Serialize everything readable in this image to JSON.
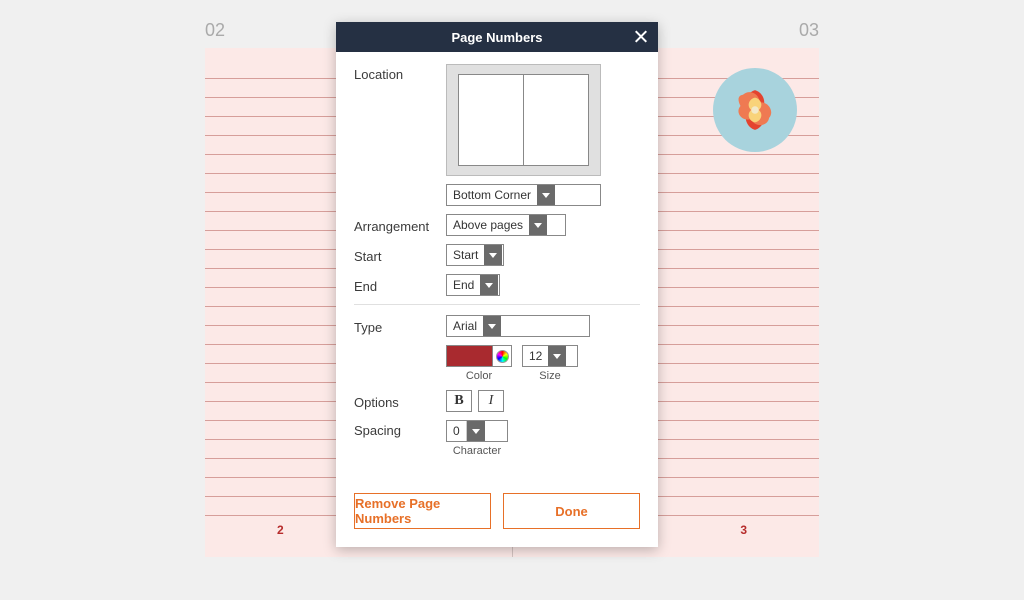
{
  "spread": {
    "left_header": "02",
    "right_header": "03",
    "left_bottom": "2",
    "right_bottom": "3"
  },
  "dialog": {
    "title": "Page Numbers",
    "labels": {
      "location": "Location",
      "arrangement": "Arrangement",
      "start": "Start",
      "end": "End",
      "type": "Type",
      "options": "Options",
      "spacing": "Spacing",
      "color": "Color",
      "size": "Size",
      "character": "Character"
    },
    "values": {
      "location": "Bottom Corner",
      "arrangement": "Above pages",
      "start": "Start",
      "end": "End",
      "type": "Arial",
      "size": "12",
      "color": "#a92a2f",
      "spacing": "0",
      "bold_glyph": "B",
      "italic_glyph": "I"
    },
    "buttons": {
      "remove": "Remove Page Numbers",
      "done": "Done"
    }
  }
}
